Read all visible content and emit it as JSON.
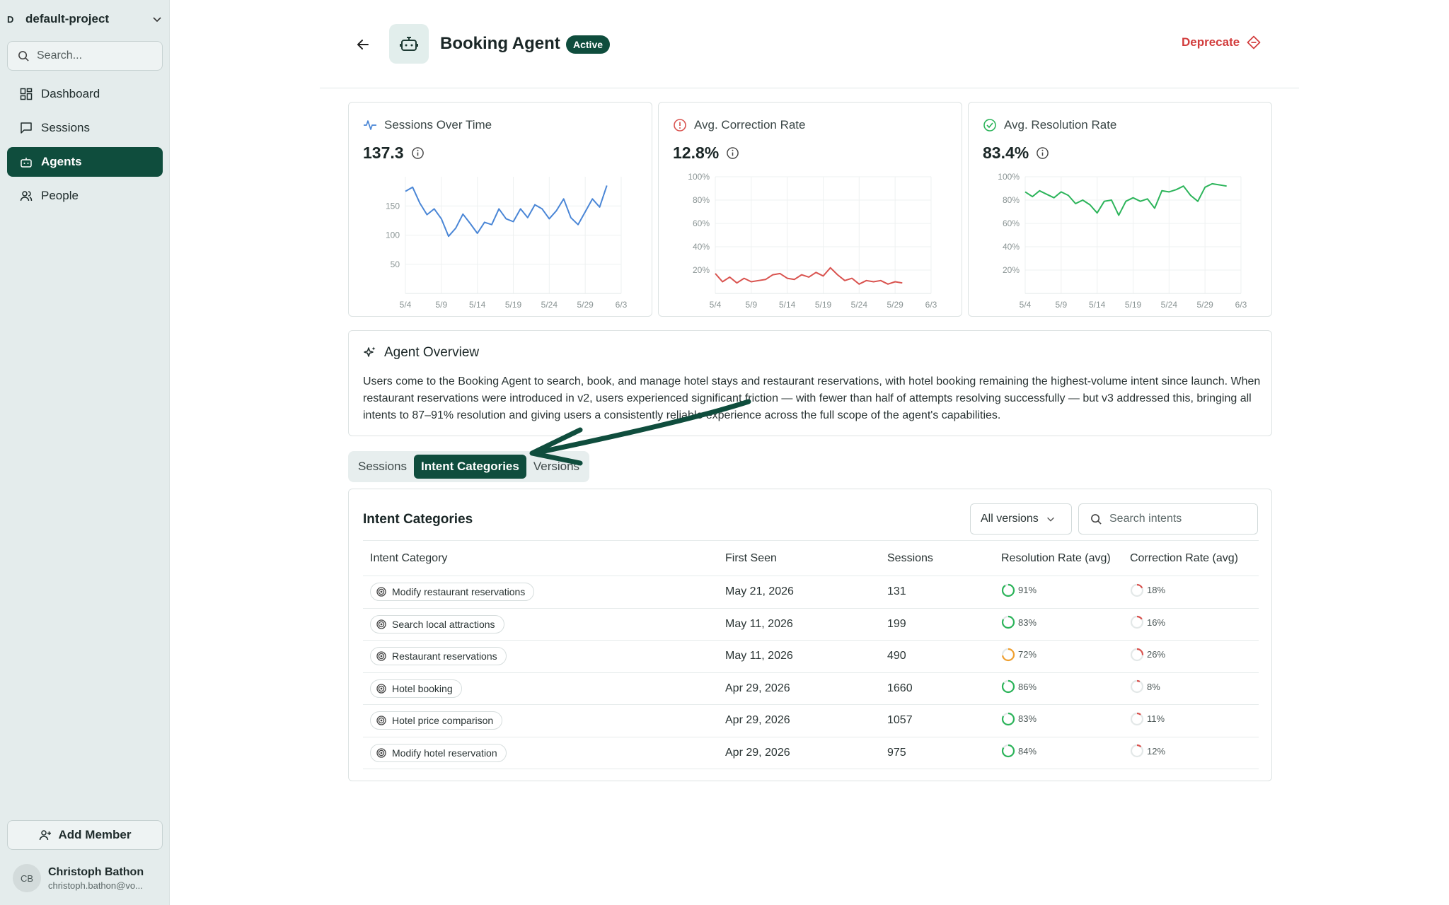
{
  "sidebar": {
    "project_badge": "D",
    "project_name": "default-project",
    "search_placeholder": "Search...",
    "nav": [
      {
        "label": "Dashboard",
        "icon": "dashboard-icon"
      },
      {
        "label": "Sessions",
        "icon": "chat-icon"
      },
      {
        "label": "Agents",
        "icon": "bot-icon",
        "active": true
      },
      {
        "label": "People",
        "icon": "people-icon"
      }
    ],
    "add_member_label": "Add Member",
    "user": {
      "initials": "CB",
      "name": "Christoph Bathon",
      "email": "christoph.bathon@vo..."
    }
  },
  "header": {
    "title": "Booking Agent",
    "status": "Active",
    "deprecate_label": "Deprecate"
  },
  "cards": [
    {
      "title": "Sessions Over Time",
      "value": "137.3",
      "color": "#4a86d6",
      "icon": "pulse-icon"
    },
    {
      "title": "Avg. Correction Rate",
      "value": "12.8%",
      "color": "#d9534f",
      "icon": "alert-circle-icon"
    },
    {
      "title": "Avg. Resolution Rate",
      "value": "83.4%",
      "color": "#2cb45a",
      "icon": "check-circle-icon"
    }
  ],
  "chart_data": [
    {
      "type": "line",
      "title": "Sessions Over Time",
      "x_ticks": [
        "5/4",
        "5/9",
        "5/14",
        "5/19",
        "5/24",
        "5/29",
        "6/3"
      ],
      "y_ticks": [
        "50",
        "100",
        "150"
      ],
      "ylim": [
        0,
        200
      ],
      "grid": true,
      "series": [
        {
          "values": [
            175,
            182,
            155,
            135,
            145,
            128,
            98,
            112,
            136,
            120,
            103,
            122,
            118,
            145,
            128,
            123,
            145,
            130,
            152,
            145,
            128,
            142,
            162,
            130,
            118,
            140,
            162,
            148,
            185
          ]
        }
      ]
    },
    {
      "type": "line",
      "title": "Avg. Correction Rate",
      "x_ticks": [
        "5/4",
        "5/9",
        "5/14",
        "5/19",
        "5/24",
        "5/29",
        "6/3"
      ],
      "y_ticks": [
        "20%",
        "40%",
        "60%",
        "80%",
        "100%"
      ],
      "ylim": [
        0,
        100
      ],
      "grid": true,
      "series": [
        {
          "values": [
            17,
            10,
            14,
            9,
            13,
            10,
            11,
            12,
            16,
            17,
            13,
            12,
            16,
            14,
            18,
            15,
            22,
            16,
            11,
            13,
            8,
            11,
            10,
            11,
            8,
            10,
            9
          ]
        }
      ]
    },
    {
      "type": "line",
      "title": "Avg. Resolution Rate",
      "x_ticks": [
        "5/4",
        "5/9",
        "5/14",
        "5/19",
        "5/24",
        "5/29",
        "6/3"
      ],
      "y_ticks": [
        "20%",
        "40%",
        "60%",
        "80%",
        "100%"
      ],
      "ylim": [
        0,
        100
      ],
      "grid": true,
      "series": [
        {
          "values": [
            87,
            83,
            88,
            85,
            82,
            87,
            84,
            77,
            80,
            76,
            69,
            79,
            80,
            67,
            79,
            82,
            79,
            81,
            73,
            88,
            87,
            89,
            92,
            84,
            79,
            91,
            94,
            93,
            92
          ]
        }
      ]
    }
  ],
  "overview": {
    "title": "Agent Overview",
    "text": "Users come to the Booking Agent to search, book, and manage hotel stays and restaurant reservations, with hotel booking remaining the highest-volume intent since launch. When restaurant reservations were introduced in v2, users experienced significant friction — with fewer than half of attempts resolving successfully — but v3 addressed this, bringing all intents to 87–91% resolution and giving users a consistently reliable experience across the full scope of the agent's capabilities."
  },
  "tabs": [
    "Sessions",
    "Intent Categories",
    "Versions"
  ],
  "intents": {
    "title": "Intent Categories",
    "version_filter": "All versions",
    "search_placeholder": "Search intents",
    "columns": [
      "Intent Category",
      "First Seen",
      "Sessions",
      "Resolution Rate (avg)",
      "Correction Rate (avg)"
    ],
    "rows": [
      {
        "name": "Modify restaurant reservations",
        "first_seen": "May 21, 2026",
        "sessions": "131",
        "resolution": "91%",
        "resolution_value": 91,
        "resolution_color": "#2cb45a",
        "correction": "18%",
        "correction_value": 18
      },
      {
        "name": "Search local attractions",
        "first_seen": "May 11, 2026",
        "sessions": "199",
        "resolution": "83%",
        "resolution_value": 83,
        "resolution_color": "#2cb45a",
        "correction": "16%",
        "correction_value": 16
      },
      {
        "name": "Restaurant reservations",
        "first_seen": "May 11, 2026",
        "sessions": "490",
        "resolution": "72%",
        "resolution_value": 72,
        "resolution_color": "#f0a030",
        "correction": "26%",
        "correction_value": 26
      },
      {
        "name": "Hotel booking",
        "first_seen": "Apr 29, 2026",
        "sessions": "1660",
        "resolution": "86%",
        "resolution_value": 86,
        "resolution_color": "#2cb45a",
        "correction": "8%",
        "correction_value": 8
      },
      {
        "name": "Hotel price comparison",
        "first_seen": "Apr 29, 2026",
        "sessions": "1057",
        "resolution": "83%",
        "resolution_value": 83,
        "resolution_color": "#2cb45a",
        "correction": "11%",
        "correction_value": 11
      },
      {
        "name": "Modify hotel reservation",
        "first_seen": "Apr 29, 2026",
        "sessions": "975",
        "resolution": "84%",
        "resolution_value": 84,
        "resolution_color": "#2cb45a",
        "correction": "12%",
        "correction_value": 12
      }
    ]
  },
  "colors": {
    "brand": "#0f4d3d",
    "danger": "#d23c3c",
    "annotation_arrow": "#0f4d3d"
  }
}
